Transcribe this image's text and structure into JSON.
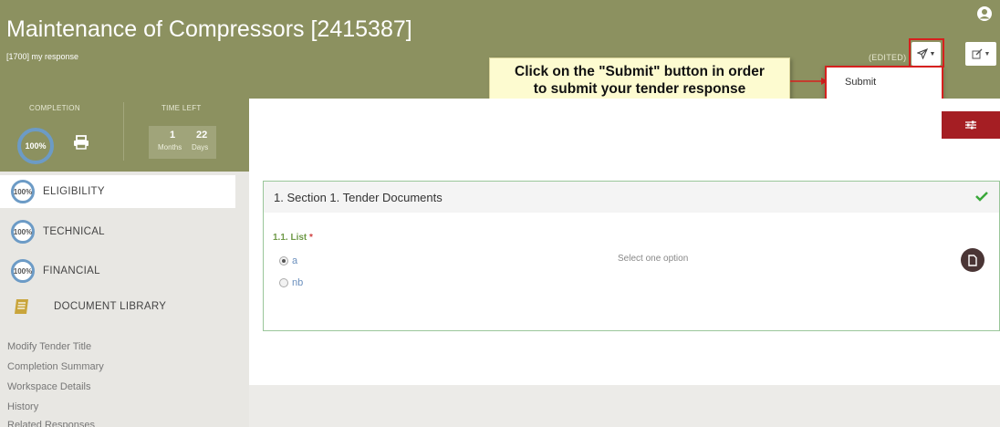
{
  "header": {
    "title": "Maintenance of Compressors [2415387]",
    "subtitle": "[1700] my response",
    "edited_status": "(EDITED)",
    "submit_menu_item": "Submit"
  },
  "callout": {
    "line1": "Click on the \"Submit\" button in order",
    "line2": "to submit your tender response"
  },
  "summary": {
    "completion_label": "COMPLETION",
    "time_left_label": "TIME LEFT",
    "completion_value": "100%",
    "months_value": "1",
    "months_unit": "Months",
    "days_value": "22",
    "days_unit": "Days"
  },
  "sidebar": {
    "sections": [
      {
        "percent": "100%",
        "label": "ELIGIBILITY"
      },
      {
        "percent": "100%",
        "label": "TECHNICAL"
      },
      {
        "percent": "100%",
        "label": "FINANCIAL"
      },
      {
        "percent": "",
        "label": "DOCUMENT LIBRARY"
      }
    ],
    "links": [
      "Modify Tender Title",
      "Completion Summary",
      "Workspace Details",
      "History",
      "Related Responses"
    ]
  },
  "main": {
    "section_title": "1. Section 1. Tender Documents",
    "question_label": "1.1. List",
    "required_mark": "*",
    "options": [
      "a",
      "nb"
    ],
    "selected_option": "a",
    "hint": "Select one option"
  },
  "colors": {
    "header_bg": "#8c9160",
    "accent_red": "#a51e23",
    "highlight_red": "#d6201e",
    "progress_ring": "#6c9bc6",
    "success_green": "#3aa83a",
    "callout_bg": "#fdfbd0"
  },
  "icons": {
    "user": "user-circle-icon",
    "submit": "paper-plane-icon",
    "edit": "edit-icon",
    "print": "printer-icon",
    "filter": "sliders-icon",
    "check": "check-icon",
    "document": "document-icon",
    "library": "book-icon"
  }
}
